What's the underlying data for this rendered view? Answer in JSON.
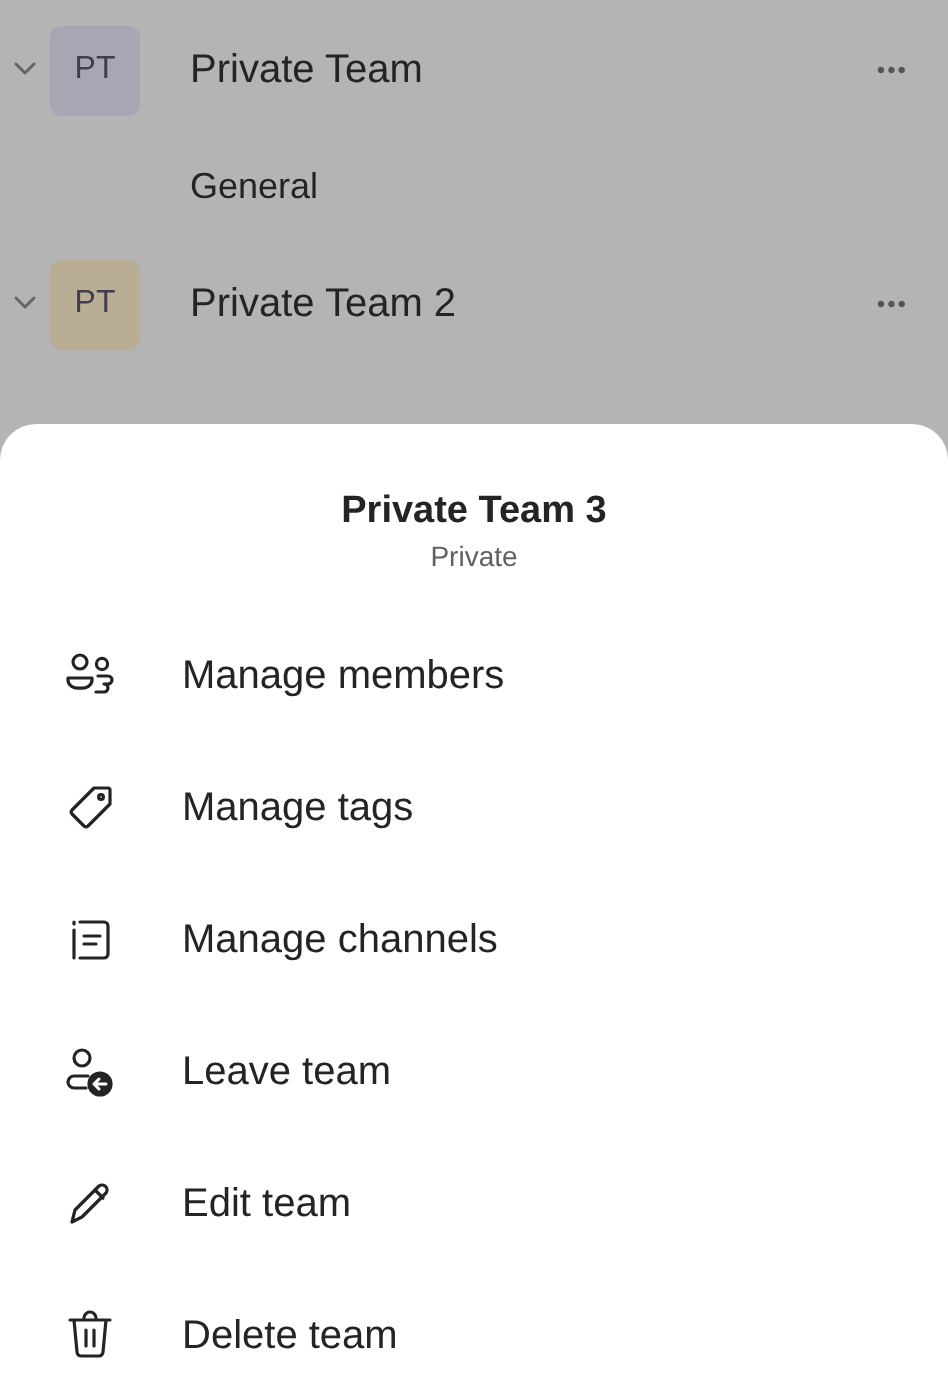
{
  "teams": [
    {
      "initials": "PT",
      "name": "Private Team",
      "color": "#a9a6b3",
      "expanded": true,
      "more": "•••",
      "channels": [
        "General"
      ]
    },
    {
      "initials": "PT",
      "name": "Private Team 2",
      "color": "#b9ae93",
      "expanded": true,
      "more": "•••"
    }
  ],
  "sheet": {
    "title": "Private Team 3",
    "subtitle": "Private",
    "actions": [
      {
        "kind": "members",
        "label": "Manage members"
      },
      {
        "kind": "tags",
        "label": "Manage tags"
      },
      {
        "kind": "channels",
        "label": "Manage channels"
      },
      {
        "kind": "leave",
        "label": "Leave team"
      },
      {
        "kind": "edit",
        "label": "Edit team"
      },
      {
        "kind": "delete",
        "label": "Delete team"
      }
    ]
  }
}
